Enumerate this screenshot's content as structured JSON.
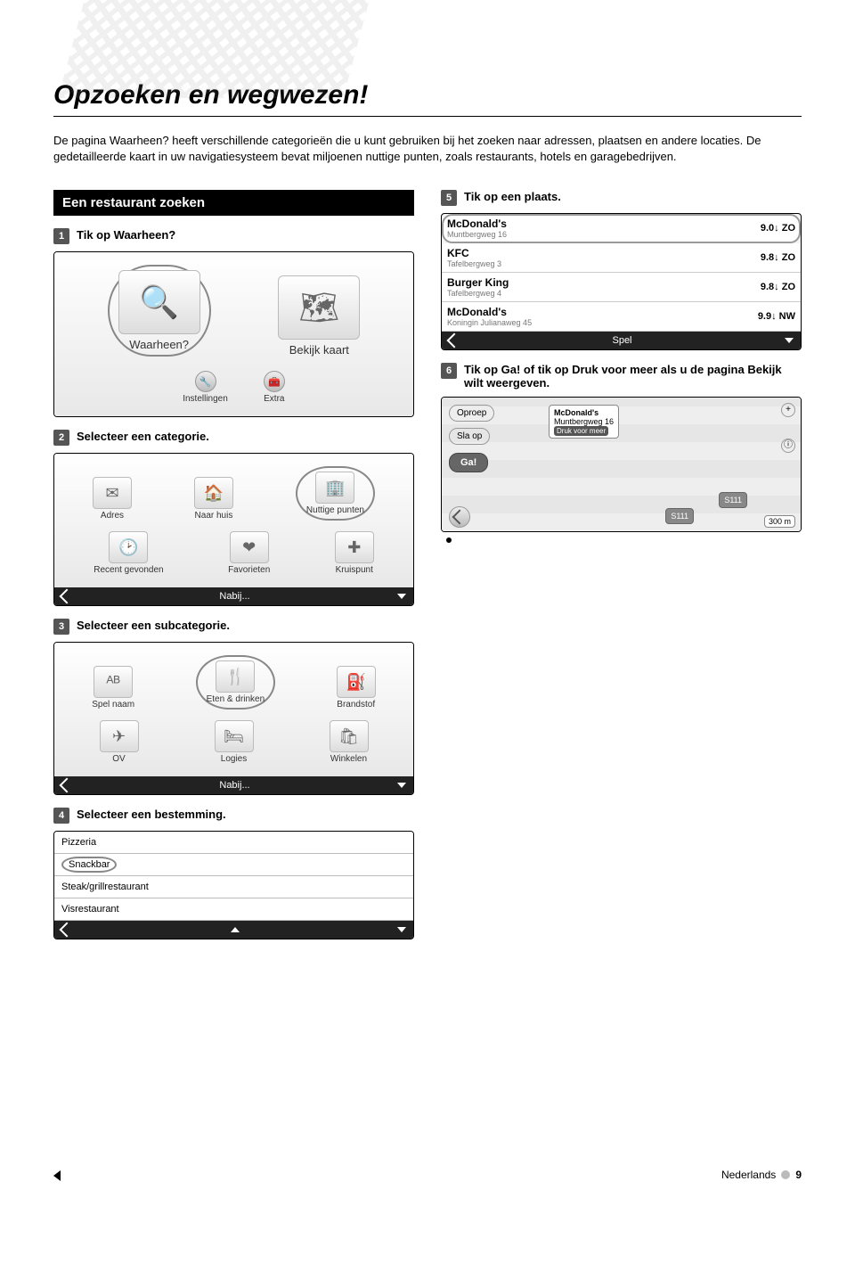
{
  "page_title": "Opzoeken en wegwezen!",
  "intro": "De pagina Waarheen? heeft verschillende categorieën die u kunt gebruiken bij het zoeken naar adressen, plaatsen en andere locaties. De gedetailleerde kaart in uw navigatiesysteem bevat miljoenen nuttige punten, zoals restaurants, hotels en garagebedrijven.",
  "section": {
    "heading": "Een restaurant zoeken"
  },
  "steps": {
    "s1": {
      "num": "1",
      "text": "Tik op Waarheen?"
    },
    "s2": {
      "num": "2",
      "text": "Selecteer een categorie."
    },
    "s3": {
      "num": "3",
      "text": "Selecteer een subcategorie."
    },
    "s4": {
      "num": "4",
      "text": "Selecteer een bestemming."
    },
    "s5": {
      "num": "5",
      "text": "Tik op een plaats."
    },
    "s6": {
      "num": "6",
      "text": "Tik op Ga! of tik op Druk voor meer als u de pagina Bekijk wilt weergeven."
    }
  },
  "shot1": {
    "waarheen": "Waarheen?",
    "bekijk": "Bekijk kaart",
    "instellingen": "Instellingen",
    "extra": "Extra"
  },
  "shot2": {
    "tiles": {
      "adres": "Adres",
      "naarhuis": "Naar huis",
      "nuttige": "Nuttige punten",
      "recent": "Recent gevonden",
      "favorieten": "Favorieten",
      "kruispunt": "Kruispunt"
    },
    "bar": "Nabij..."
  },
  "shot3": {
    "tiles": {
      "spel": "Spel naam",
      "eten": "Eten & drinken",
      "brandstof": "Brandstof",
      "ov": "OV",
      "logies": "Logies",
      "winkelen": "Winkelen"
    },
    "bar": "Nabij..."
  },
  "shot4": {
    "rows": {
      "r1": "Pizzeria",
      "r2": "Snackbar",
      "r3": "Steak/grillrestaurant",
      "r4": "Visrestaurant"
    }
  },
  "shot5": {
    "rows": [
      {
        "name": "McDonald's",
        "sub": "Muntbergweg 16",
        "dist": "9.0↓",
        "dir": "ZO"
      },
      {
        "name": "KFC",
        "sub": "Tafelbergweg 3",
        "dist": "9.8↓",
        "dir": "ZO"
      },
      {
        "name": "Burger King",
        "sub": "Tafelbergweg 4",
        "dist": "9.8↓",
        "dir": "ZO"
      },
      {
        "name": "McDonald's",
        "sub": "Koningin Julianaweg 45",
        "dist": "9.9↓",
        "dir": "NW"
      }
    ],
    "bar": "Spel"
  },
  "shot6": {
    "oproep": "Oproep",
    "slaop": "Sla op",
    "ga": "Ga!",
    "callout_name": "McDonald's",
    "callout_addr": "Muntbergweg 16",
    "druk": "Druk voor meer",
    "road1": "S111",
    "road2": "S111",
    "scale": "300 m"
  },
  "footer": {
    "lang": "Nederlands",
    "page": "9"
  }
}
